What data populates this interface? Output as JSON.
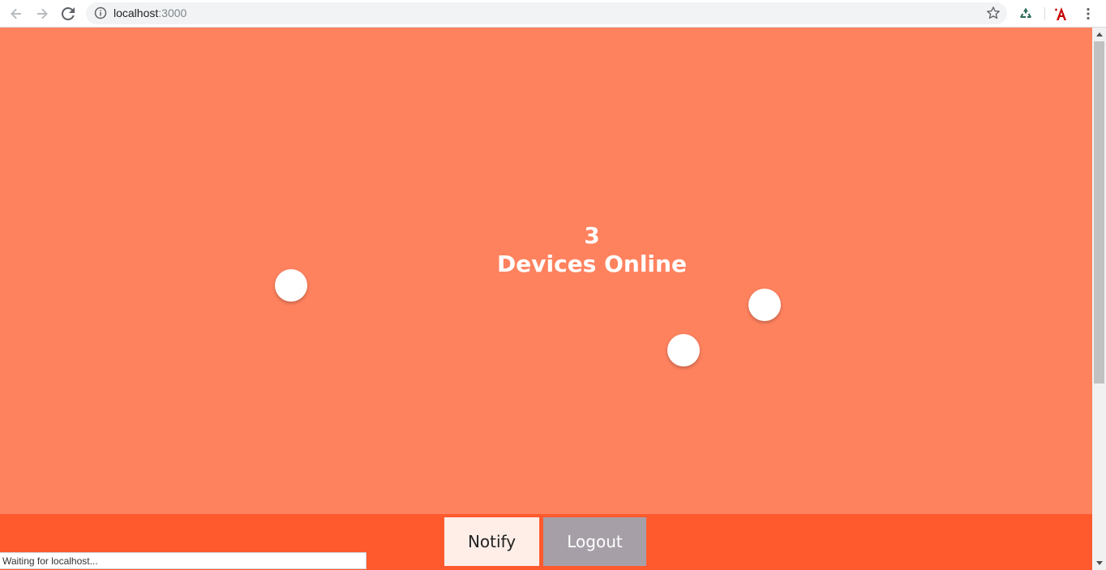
{
  "browser": {
    "url_host": "localhost",
    "url_port": ":3000",
    "status_text": "Waiting for localhost..."
  },
  "icons": {
    "back": "back-arrow-icon",
    "forward": "forward-arrow-icon",
    "reload": "reload-icon",
    "info": "info-icon",
    "star": "star-icon",
    "recycle_extension": "recycle-icon",
    "acrobat_extension": "acrobat-icon",
    "menu": "kebab-menu-icon"
  },
  "main": {
    "device_count": "3",
    "caption": "Devices Online"
  },
  "footer": {
    "notify_label": "Notify",
    "logout_label": "Logout"
  },
  "colors": {
    "background": "#ff825f",
    "footer": "#ff5a2d",
    "notify_button": "#ffeee8",
    "logout_button": "#a69fa8"
  }
}
